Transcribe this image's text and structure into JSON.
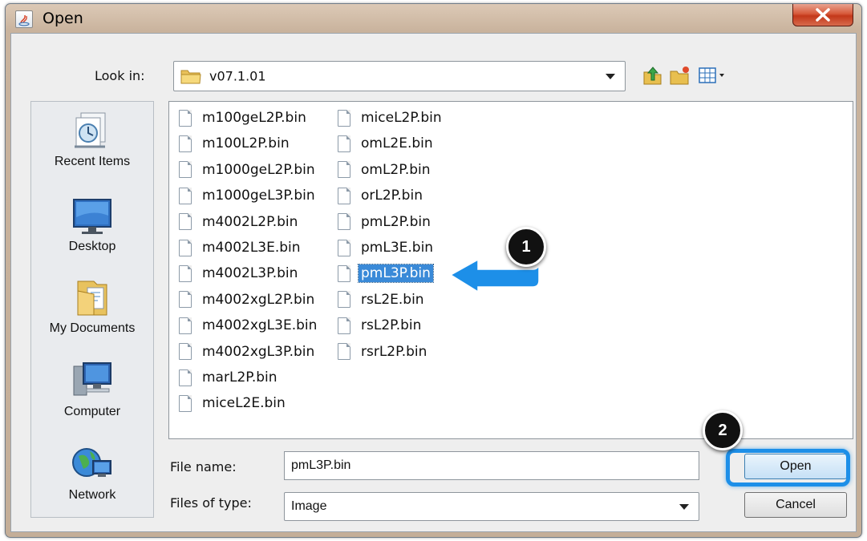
{
  "window": {
    "title": "Open"
  },
  "look_in": {
    "label": "Look in:",
    "value": "v07.1.01"
  },
  "places": [
    {
      "label": "Recent Items",
      "icon": "recent-items-icon"
    },
    {
      "label": "Desktop",
      "icon": "desktop-icon"
    },
    {
      "label": "My Documents",
      "icon": "my-documents-icon"
    },
    {
      "label": "Computer",
      "icon": "computer-icon"
    },
    {
      "label": "Network",
      "icon": "network-icon"
    }
  ],
  "files": {
    "column1": [
      "m100geL2P.bin",
      "m100L2P.bin",
      "m1000geL2P.bin",
      "m1000geL3P.bin",
      "m4002L2P.bin",
      "m4002L3E.bin",
      "m4002L3P.bin",
      "m4002xgL2P.bin",
      "m4002xgL3E.bin",
      "m4002xgL3P.bin",
      "marL2P.bin",
      "miceL2E.bin"
    ],
    "column2": [
      "miceL2P.bin",
      "omL2E.bin",
      "omL2P.bin",
      "orL2P.bin",
      "pmL2P.bin",
      "pmL3E.bin",
      "pmL3P.bin",
      "rsL2E.bin",
      "rsL2P.bin",
      "rsrL2P.bin"
    ],
    "selected": "pmL3P.bin"
  },
  "file_name": {
    "label": "File name:",
    "value": "pmL3P.bin"
  },
  "file_type": {
    "label": "Files of type:",
    "value": "Image"
  },
  "buttons": {
    "open": "Open",
    "cancel": "Cancel"
  },
  "callouts": {
    "step1": "1",
    "step2": "2"
  },
  "colors": {
    "selection": "#3a8ad8",
    "callout_accent": "#1d8fe8",
    "title_bar": "#c9b39d",
    "close_button": "#c3381a"
  }
}
